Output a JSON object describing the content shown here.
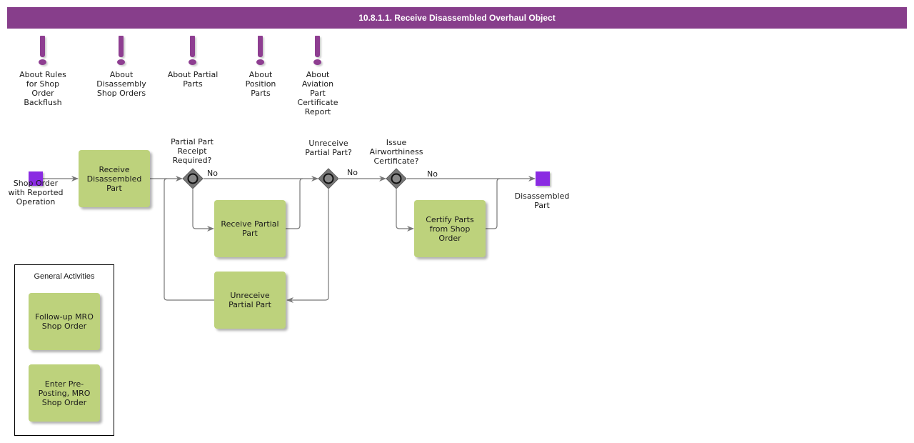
{
  "header": {
    "title": "10.8.1.1. Receive Disassembled Overhaul Object",
    "color": "#873e8b"
  },
  "notes": [
    {
      "icon": "exclamation-icon",
      "label": "About Rules for Shop Order Backflush"
    },
    {
      "icon": "exclamation-icon",
      "label": "About Disassembly Shop Orders"
    },
    {
      "icon": "exclamation-icon",
      "label": "About Partial Parts"
    },
    {
      "icon": "exclamation-icon",
      "label": "About Position Parts"
    },
    {
      "icon": "exclamation-icon",
      "label": "About Aviation Part Certificate Report"
    }
  ],
  "events": {
    "start": {
      "label": "Shop Order with Reported Operation"
    },
    "end": {
      "label": "Disassembled Part"
    },
    "color": "#8a2be2"
  },
  "tasks": {
    "receive_disassembled": "Receive Disassembled Part",
    "receive_partial": "Receive Partial Part",
    "unreceive_partial": "Unreceive Partial Part",
    "certify_parts": "Certify Parts from Shop Order",
    "color": "#bdd27c"
  },
  "gateways": {
    "partial_receipt": {
      "question": "Partial Part Receipt Required?",
      "no_label": "No"
    },
    "unreceive": {
      "question": "Unreceive Partial Part?",
      "no_label": "No"
    },
    "airworthiness": {
      "question": "Issue Airworthiness Certificate?",
      "no_label": "No"
    }
  },
  "general_activities": {
    "title": "General Activities",
    "items": [
      "Follow-up MRO Shop Order",
      "Enter Pre-Posting, MRO Shop Order"
    ]
  }
}
